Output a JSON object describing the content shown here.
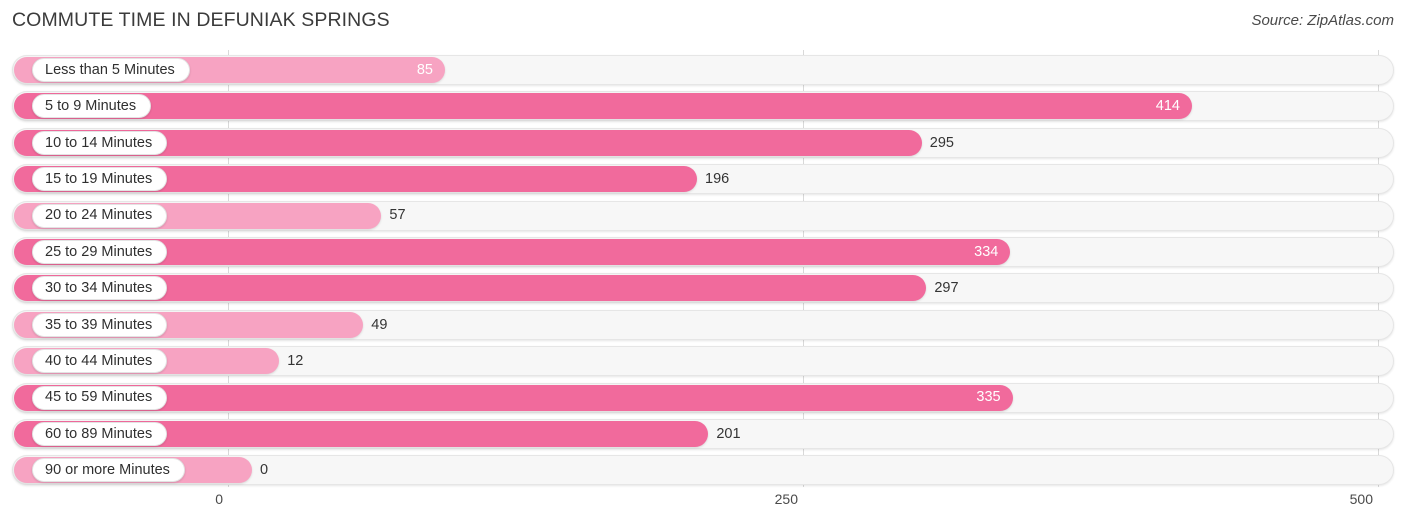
{
  "header": {
    "title": "COMMUTE TIME IN DEFUNIAK SPRINGS",
    "source": "Source: ZipAtlas.com"
  },
  "colors": {
    "bar_light": "#f7a3c2",
    "bar_dark": "#f16a9c",
    "track": "#f7f7f7",
    "gridline": "#d9d9d9",
    "value_outside_text": "#343434",
    "value_inside_text": "#ffffff"
  },
  "chart_data": {
    "type": "bar",
    "orientation": "horizontal",
    "title": "COMMUTE TIME IN DEFUNIAK SPRINGS",
    "xlabel": "",
    "ylabel": "",
    "xlim": [
      0,
      500
    ],
    "xticks": [
      "0",
      "250",
      "500"
    ],
    "xtick_values": [
      0,
      250,
      500
    ],
    "grid": true,
    "legend": false,
    "categories": [
      "Less than 5 Minutes",
      "5 to 9 Minutes",
      "10 to 14 Minutes",
      "15 to 19 Minutes",
      "20 to 24 Minutes",
      "25 to 29 Minutes",
      "30 to 34 Minutes",
      "35 to 39 Minutes",
      "40 to 44 Minutes",
      "45 to 59 Minutes",
      "60 to 89 Minutes",
      "90 or more Minutes"
    ],
    "values": [
      85,
      414,
      295,
      196,
      57,
      334,
      297,
      49,
      12,
      335,
      201,
      0
    ],
    "value_labels": [
      "85",
      "414",
      "295",
      "196",
      "57",
      "334",
      "297",
      "49",
      "12",
      "335",
      "201",
      "0"
    ],
    "rows": [
      {
        "label": "Less than 5 Minutes",
        "value": 85,
        "value_label": "85",
        "shade": "light",
        "label_inside": true
      },
      {
        "label": "5 to 9 Minutes",
        "value": 414,
        "value_label": "414",
        "shade": "dark",
        "label_inside": true
      },
      {
        "label": "10 to 14 Minutes",
        "value": 295,
        "value_label": "295",
        "shade": "dark",
        "label_inside": false
      },
      {
        "label": "15 to 19 Minutes",
        "value": 196,
        "value_label": "196",
        "shade": "dark",
        "label_inside": false
      },
      {
        "label": "20 to 24 Minutes",
        "value": 57,
        "value_label": "57",
        "shade": "light",
        "label_inside": false
      },
      {
        "label": "25 to 29 Minutes",
        "value": 334,
        "value_label": "334",
        "shade": "dark",
        "label_inside": true
      },
      {
        "label": "30 to 34 Minutes",
        "value": 297,
        "value_label": "297",
        "shade": "dark",
        "label_inside": false
      },
      {
        "label": "35 to 39 Minutes",
        "value": 49,
        "value_label": "49",
        "shade": "light",
        "label_inside": false
      },
      {
        "label": "40 to 44 Minutes",
        "value": 12,
        "value_label": "12",
        "shade": "light",
        "label_inside": false
      },
      {
        "label": "45 to 59 Minutes",
        "value": 335,
        "value_label": "335",
        "shade": "dark",
        "label_inside": true
      },
      {
        "label": "60 to 89 Minutes",
        "value": 201,
        "value_label": "201",
        "shade": "dark",
        "label_inside": false
      },
      {
        "label": "90 or more Minutes",
        "value": 0,
        "value_label": "0",
        "shade": "light",
        "label_inside": false
      }
    ]
  }
}
